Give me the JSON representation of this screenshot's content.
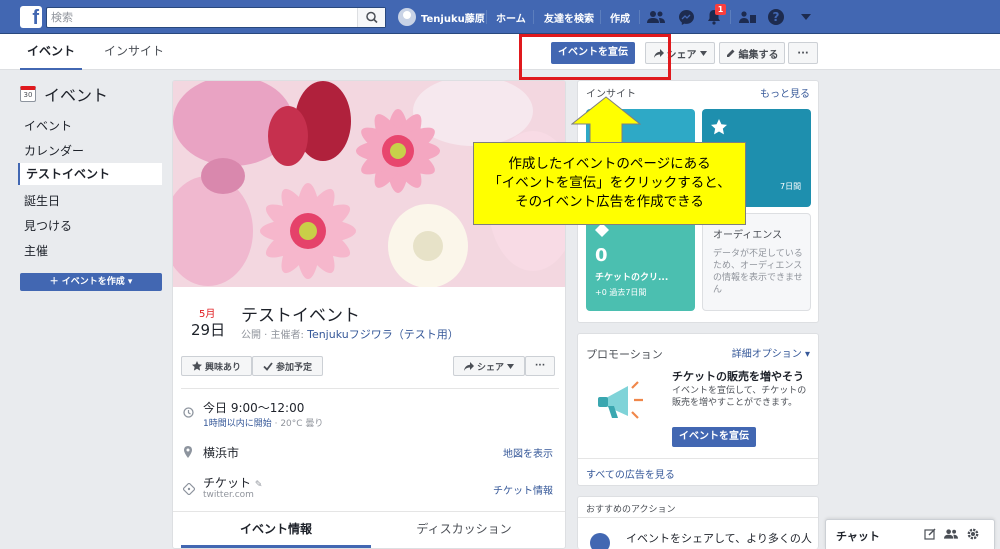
{
  "topbar": {
    "search_placeholder": "検索",
    "user_name": "Tenjuku藤原",
    "nav_home": "ホーム",
    "nav_find_friends": "友達を検索",
    "nav_create": "作成",
    "notification_count": "1"
  },
  "subbar": {
    "tab_events": "イベント",
    "tab_insight": "インサイト",
    "promote_label": "イベントを宣伝",
    "share_label": "シェア",
    "edit_label": "編集する",
    "more_label": "···"
  },
  "sidebar": {
    "title": "イベント",
    "cal_num": "30",
    "items": [
      "イベント",
      "カレンダー",
      "テストイベント",
      "誕生日",
      "見つける",
      "主催"
    ],
    "create_label": "＋ イベントを作成 ▾"
  },
  "event": {
    "month": "5月",
    "day": "29日",
    "title": "テストイベント",
    "meta_prefix": "公開 · 主催者: ",
    "host": "Tenjukuフジワラ（テスト用）",
    "interested_label": "興味あり",
    "going_label": "参加予定",
    "share_label": "シェア",
    "more_label": "···",
    "time_main": "今日 9:00～12:00",
    "time_sub_blue": "1時間以内に開始",
    "time_sub_rest": " · 20°C 曇り",
    "location": "横浜市",
    "map_link": "地図を表示",
    "ticket_main": "チケット",
    "ticket_sub": "twitter.com",
    "ticket_link": "チケット情報",
    "tab_info": "イベント情報",
    "tab_discussion": "ディスカッション"
  },
  "insight": {
    "head": "インサイト",
    "more_link": "もっと見る",
    "tile2_sub": "7日間",
    "ticket_tile_value": "0",
    "ticket_tile_label": "チケットのクリ...",
    "ticket_tile_sub": "+0 過去7日間",
    "audience_title": "オーディエンス",
    "audience_text": "データが不足しているため、オーディエンスの情報を表示できません"
  },
  "promotion": {
    "head": "プロモーション",
    "options_link": "詳細オプション ▾",
    "title": "チケットの販売を増やそう",
    "desc": "イベントを宣伝して、チケットの販売を増やすことができます。",
    "button": "イベントを宣伝",
    "all_ads_link": "すべての広告を見る"
  },
  "actions": {
    "head": "おすすめのアクション",
    "text": "イベントをシェアして、より多くの人に"
  },
  "callout": {
    "lines": [
      "作成したイベントのページにある",
      "「イベントを宣伝」をクリックすると、",
      "そのイベント広告を作成できる"
    ]
  },
  "chat": {
    "label": "チャット"
  },
  "colors": {
    "brand": "#4267b2",
    "highlight": "#ffff00",
    "annotation_red": "#e0191d",
    "teal": "#4bbfb0",
    "cyan": "#2ea9c6"
  }
}
